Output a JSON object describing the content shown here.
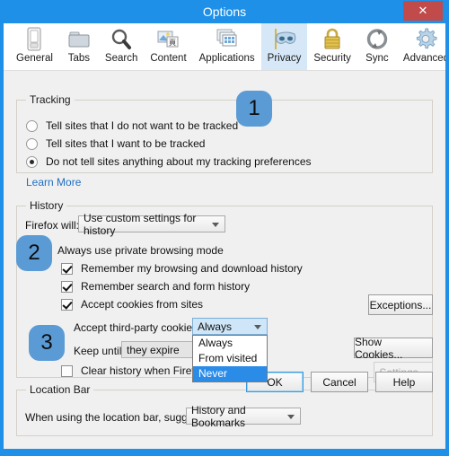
{
  "window": {
    "title": "Options",
    "close_label": "✕"
  },
  "tabs": [
    {
      "label": "General",
      "icon": "general-icon",
      "selected": false
    },
    {
      "label": "Tabs",
      "icon": "tabs-icon",
      "selected": false
    },
    {
      "label": "Search",
      "icon": "search-icon",
      "selected": false
    },
    {
      "label": "Content",
      "icon": "content-icon",
      "selected": false
    },
    {
      "label": "Applications",
      "icon": "applications-icon",
      "selected": false
    },
    {
      "label": "Privacy",
      "icon": "privacy-mask-icon",
      "selected": true
    },
    {
      "label": "Security",
      "icon": "lock-icon",
      "selected": false
    },
    {
      "label": "Sync",
      "icon": "sync-icon",
      "selected": false
    },
    {
      "label": "Advanced",
      "icon": "gear-icon",
      "selected": false
    }
  ],
  "tracking": {
    "group_title": "Tracking",
    "options": [
      {
        "label": "Tell sites that I do not want to be tracked",
        "selected": false
      },
      {
        "label": "Tell sites that I want to be tracked",
        "selected": false
      },
      {
        "label": "Do not tell sites anything about my tracking preferences",
        "selected": true
      }
    ],
    "learn_more": "Learn More"
  },
  "history": {
    "group_title": "History",
    "firefox_will_label": "Firefox will:",
    "firefox_will_value": "Use custom settings for history",
    "private_browsing_label": "Always use private browsing mode",
    "private_browsing_checked": false,
    "checkboxes": [
      {
        "label": "Remember my browsing and download history",
        "checked": true
      },
      {
        "label": "Remember search and form history",
        "checked": true
      },
      {
        "label": "Accept cookies from sites",
        "checked": true
      }
    ],
    "third_party_label": "Accept third-party cookies:",
    "third_party_value": "Always",
    "third_party_options": [
      "Always",
      "From visited",
      "Never"
    ],
    "third_party_highlighted": "Never",
    "keep_until_label": "Keep until:",
    "keep_until_value": "they expire",
    "clear_history_label": "Clear history when Firefox clo",
    "clear_history_checked": false,
    "exceptions_button": "Exceptions...",
    "show_cookies_button": "Show Cookies...",
    "settings_button": "Settings...",
    "settings_disabled": true
  },
  "location_bar": {
    "group_title": "Location Bar",
    "suggest_label": "When using the location bar, suggest:",
    "suggest_value": "History and Bookmarks"
  },
  "footer": {
    "ok": "OK",
    "cancel": "Cancel",
    "help": "Help"
  },
  "callouts": [
    {
      "number": "1"
    },
    {
      "number": "2"
    },
    {
      "number": "3"
    }
  ],
  "colors": {
    "window_chrome": "#1e90e8",
    "accent_selection": "#2b8ce8",
    "callout_blue": "#5b9bd5",
    "close_red": "#c14a4a",
    "link_blue": "#1f6fc4",
    "tab_selected": "#d6e8f7"
  }
}
